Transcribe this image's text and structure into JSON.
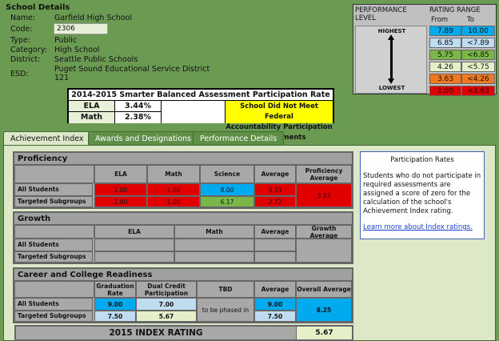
{
  "school": {
    "title": "School Details",
    "fields": [
      {
        "label": "Name:",
        "value": "Garfield High School"
      },
      {
        "label": "Code:",
        "value": "2306"
      },
      {
        "label": "Type:",
        "value": "Public"
      },
      {
        "label": "Category:",
        "value": "High School"
      },
      {
        "label": "District:",
        "value": "Seattle Public Schools"
      },
      {
        "label": "ESD:",
        "value": "Puget Sound Educational Service District"
      },
      {
        "label": "",
        "value": "121"
      }
    ]
  },
  "participation": {
    "title": "2014-2015 Smarter Balanced Assessment Participation Rate",
    "rows": [
      {
        "subject": "ELA",
        "rate": "3.44%"
      },
      {
        "subject": "Math",
        "rate": "2.38%"
      }
    ],
    "warning_line1": "School Did Not Meet Federal",
    "warning_line2": "Accountability Participation Requirements"
  },
  "legend": {
    "perf_line1": "PERFORMANCE",
    "perf_line2": "LEVEL",
    "range_title": "RATING RANGE",
    "col_from": "From",
    "col_to": "To",
    "highest": "HIGHEST",
    "lowest": "LOWEST",
    "ranges": [
      {
        "from": "7.89",
        "to": "10.00",
        "color": "#00aaee"
      },
      {
        "from": "6.85",
        "to": "<7.89",
        "color": "#bfdcf0"
      },
      {
        "from": "5.75",
        "to": "<6.85",
        "color": "#7ab648"
      },
      {
        "from": "4.26",
        "to": "<5.75",
        "color": "#e6f0c8"
      },
      {
        "from": "3.63",
        "to": "<4.26",
        "color": "#f07820"
      },
      {
        "from": "1.00",
        "to": "<3.63",
        "color": "#e00000"
      }
    ]
  },
  "tabs": [
    {
      "label": "Achievement Index",
      "active": true
    },
    {
      "label": "Awards and Designations",
      "active": false
    },
    {
      "label": "Performance Details",
      "active": false
    }
  ],
  "proficiency": {
    "heading": "Proficiency",
    "cols": [
      "ELA",
      "Math",
      "Science",
      "Average",
      "Proficiency Average"
    ],
    "row1_label": "All Students",
    "row2_label": "Targeted Subgroups",
    "all": [
      "1.00",
      "1.00",
      "8.00",
      "3.33"
    ],
    "targeted": [
      "1.00",
      "1.00",
      "6.17",
      "2.72"
    ],
    "overall": "3.03"
  },
  "growth": {
    "heading": "Growth",
    "cols": [
      "ELA",
      "Math",
      "Average",
      "Growth Average"
    ],
    "row1_label": "All Students",
    "row2_label": "Targeted Subgroups"
  },
  "ccr": {
    "heading": "Career and College Readiness",
    "col1_line1": "Graduation",
    "col1_line2": "Rate",
    "col2_line1": "Dual Credit",
    "col2_line2": "Participation",
    "col3": "TBD",
    "col4": "Average",
    "col5": "Overall Average",
    "row1_label": "All Students",
    "row2_label": "Targeted Subgroups",
    "all": [
      "9.00",
      "7.00",
      "9.00"
    ],
    "targeted": [
      "7.50",
      "5.67",
      "7.50"
    ],
    "tbd_text": "to be phased in",
    "overall": "8.25"
  },
  "index": {
    "label": "2015 INDEX RATING",
    "value": "5.67"
  },
  "side_note": {
    "title": "Participation Rates",
    "body": "Students who do not participate in required assessments are assigned a score of zero for the calculation of the school's Achievement Index rating.",
    "link": "Learn more about Index ratings."
  }
}
